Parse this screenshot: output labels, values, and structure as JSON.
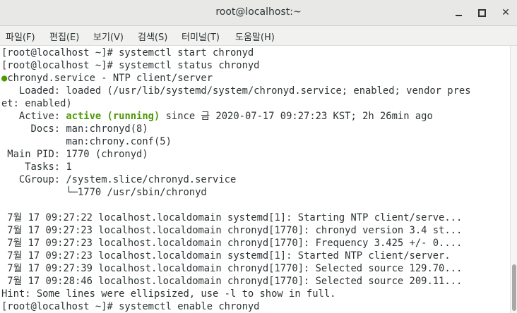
{
  "window": {
    "title": "root@localhost:~",
    "minimize_icon": "minimize-icon",
    "maximize_icon": "maximize-icon",
    "close_symbol": "✕"
  },
  "menu": [
    "파일(F)",
    "편집(E)",
    "보기(V)",
    "검색(S)",
    "터미널(T)",
    "도움말(H)"
  ],
  "terminal": {
    "lines": [
      "[root@localhost ~]# systemctl start chronyd",
      "[root@localhost ~]# systemctl status chronyd",
      "chronyd.service - NTP client/server",
      "   Loaded: loaded (/usr/lib/systemd/system/chronyd.service; enabled; vendor pres",
      "et: enabled)",
      "active (running)",
      " since 금 2020-07-17 09:27:23 KST; 2h 26min ago",
      "     Docs: man:chronyd(8)",
      "           man:chrony.conf(5)",
      " Main PID: 1770 (chronyd)",
      "    Tasks: 1",
      "   CGroup: /system.slice/chronyd.service",
      "           └─1770 /usr/sbin/chronyd",
      "",
      " 7월 17 09:27:22 localhost.localdomain systemd[1]: Starting NTP client/serve...",
      " 7월 17 09:27:23 localhost.localdomain chronyd[1770]: chronyd version 3.4 st...",
      " 7월 17 09:27:23 localhost.localdomain chronyd[1770]: Frequency 3.425 +/- 0....",
      " 7월 17 09:27:23 localhost.localdomain systemd[1]: Started NTP client/server.",
      " 7월 17 09:27:39 localhost.localdomain chronyd[1770]: Selected source 129.70...",
      " 7월 17 09:28:46 localhost.localdomain chronyd[1770]: Selected source 209.11...",
      "Hint: Some lines were ellipsized, use -l to show in full.",
      "[root@localhost ~]# systemctl enable chronyd"
    ],
    "active_prefix": "   Active: ",
    "status_dot": "●",
    "status_dot_color": "#4e9a06",
    "active_color": "#4e9a06"
  },
  "colors": {
    "titlebar_bg": "#e8e8e7",
    "menubar_bg": "#f1f1f0",
    "terminal_bg": "#ffffff",
    "text": "#2e3436"
  }
}
